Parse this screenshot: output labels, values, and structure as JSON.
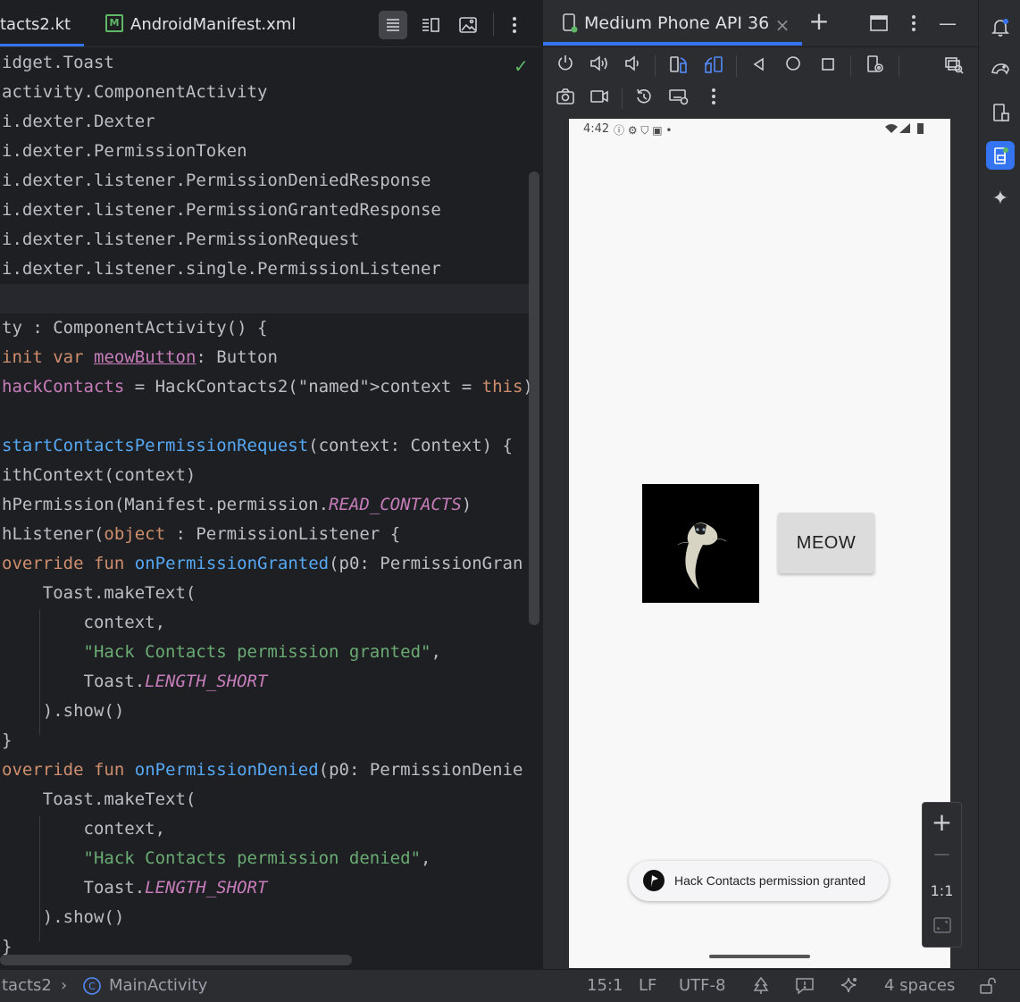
{
  "editor": {
    "tabs": [
      {
        "label": "tacts2.kt"
      },
      {
        "label": "AndroidManifest.xml",
        "badge": "M"
      }
    ],
    "lines": [
      "idget.Toast",
      "activity.ComponentActivity",
      "i.dexter.Dexter",
      "i.dexter.PermissionToken",
      "i.dexter.listener.PermissionDeniedResponse",
      "i.dexter.listener.PermissionGrantedResponse",
      "i.dexter.listener.PermissionRequest",
      "i.dexter.listener.single.PermissionListener",
      "",
      "ty : ComponentActivity() {",
      "init var meowButton: Button",
      "hackContacts = HackContacts2(context = this)",
      "",
      "startContactsPermissionRequest(context: Context) {",
      "ithContext(context)",
      "hPermission(Manifest.permission.READ_CONTACTS)",
      "hListener(object : PermissionListener {",
      "override fun onPermissionGranted(p0: PermissionGran",
      "    Toast.makeText(",
      "        context,",
      "        \"Hack Contacts permission granted\",",
      "        Toast.LENGTH_SHORT",
      "    ).show()",
      "}",
      "override fun onPermissionDenied(p0: PermissionDenie",
      "    Toast.makeText(",
      "        context,",
      "        \"Hack Contacts permission denied\",",
      "        Toast.LENGTH_SHORT",
      "    ).show()",
      "}"
    ]
  },
  "emulator": {
    "tab_label": "Medium Phone API 36",
    "phone": {
      "time": "4:42",
      "button_label": "MEOW",
      "toast": "Hack Contacts permission granted"
    },
    "zoom": {
      "plus": "+",
      "minus": "—",
      "ratio": "1:1"
    }
  },
  "statusbar": {
    "breadcrumb_file": "tacts2",
    "breadcrumb_class": "MainActivity",
    "position": "15:1",
    "line_sep": "LF",
    "encoding": "UTF-8",
    "indent": "4 spaces"
  }
}
